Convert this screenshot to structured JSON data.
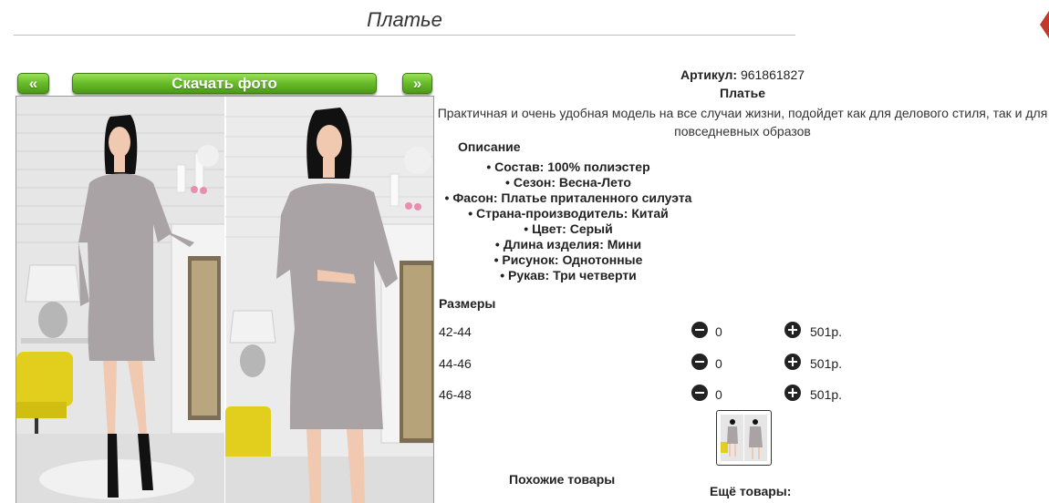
{
  "page": {
    "title": "Платье"
  },
  "photo_toolbar": {
    "prev_label": "«",
    "download_label": "Скачать фото",
    "next_label": "»"
  },
  "product": {
    "article_label": "Артикул:",
    "article_value": "961861827",
    "name": "Платье",
    "description": "Практичная и очень удобная модель на все случаи жизни, подойдет как для делового стиля, так и для повседневных образов",
    "description_title": "Описание",
    "specs": [
      "Состав: 100% полиэстер",
      "Сезон: Весна-Лето",
      "Фасон: Платье приталенного силуэта",
      "Страна-производитель: Китай",
      "Цвет: Серый",
      "Длина изделия: Мини",
      "Рисунок: Однотонные",
      "Рукав: Три четверти"
    ]
  },
  "sizes": {
    "title": "Размеры",
    "rows": [
      {
        "size": "42-44",
        "qty": "0",
        "price": "501р."
      },
      {
        "size": "44-46",
        "qty": "0",
        "price": "501р."
      },
      {
        "size": "46-48",
        "qty": "0",
        "price": "501р."
      }
    ]
  },
  "sections": {
    "similar_title": "Похожие товары",
    "more_title": "Ещё товары:"
  },
  "colors": {
    "accent_green": "#6bbf2b",
    "corner_mark_red": "#c0392b",
    "dress_gray": "#aaa3a6"
  }
}
